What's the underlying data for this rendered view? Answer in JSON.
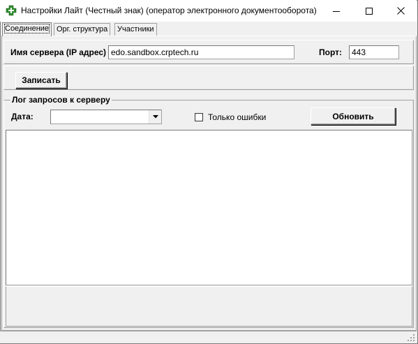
{
  "window": {
    "title": "Настройки Лайт (Честный знак) (оператор электронного документооборота)",
    "accent_icon_color": "#2e8b2e"
  },
  "tabs": [
    {
      "label": "Соединение",
      "active": true
    },
    {
      "label": "Орг. структура",
      "active": false
    },
    {
      "label": "Участники",
      "active": false
    }
  ],
  "server": {
    "label": "Имя сервера (IP адрес)",
    "value": "edo.sandbox.crptech.ru",
    "port_label": "Порт:",
    "port_value": "443"
  },
  "actions": {
    "save_label": "Записать"
  },
  "log": {
    "legend": "Лог запросов к серверу",
    "date_label": "Дата:",
    "date_value": "",
    "errors_only_label": "Только ошибки",
    "errors_only_checked": false,
    "refresh_label": "Обновить"
  }
}
